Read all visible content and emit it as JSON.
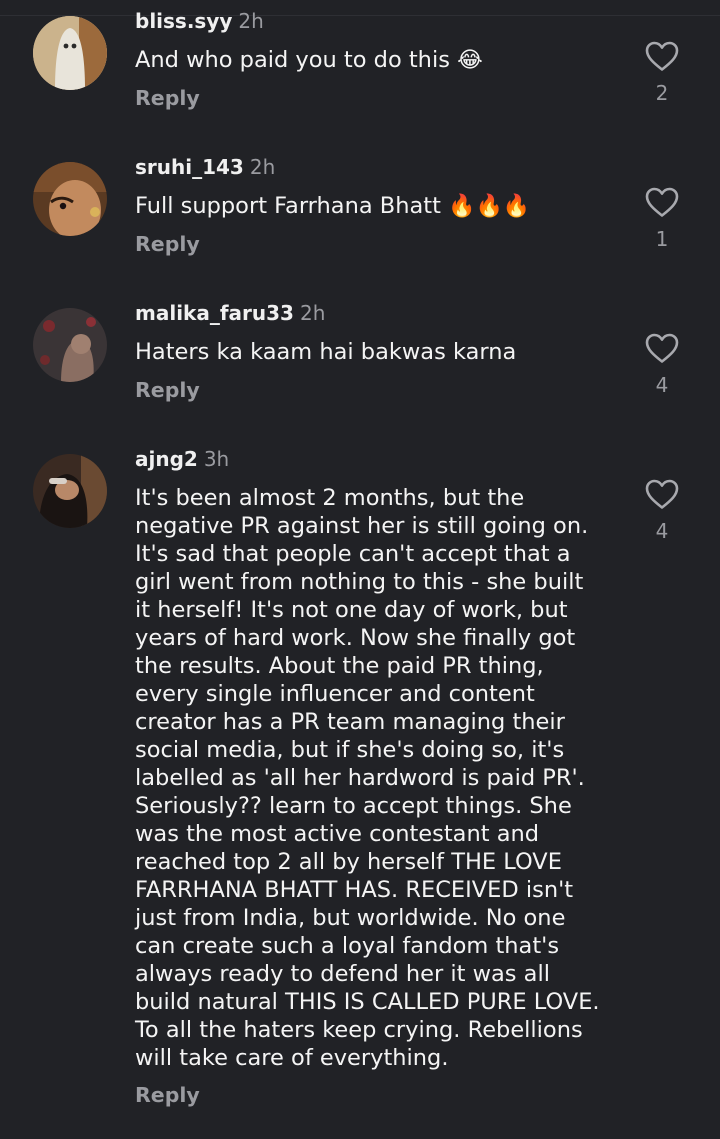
{
  "comments": [
    {
      "username": "bliss.syy",
      "time": "2h",
      "text": "And who paid you to do this",
      "emoji": "😂",
      "reply_label": "Reply",
      "likes": "2"
    },
    {
      "username": "sruhi_143",
      "time": "2h",
      "text": "Full support Farrhana Bhatt",
      "emoji": "🔥🔥🔥",
      "reply_label": "Reply",
      "likes": "1"
    },
    {
      "username": "malika_faru33",
      "time": "2h",
      "text": "Haters ka kaam hai bakwas karna",
      "reply_label": "Reply",
      "likes": "4"
    },
    {
      "username": "ajng2",
      "time": "3h",
      "text": "It's been almost 2 months, but the negative PR against her is still going on. It's sad that people can't accept that a girl went from nothing to this - she built it herself! It's not one day of work, but years of hard work. Now she finally got the results. About the paid PR thing, every single influencer and content creator has a PR team managing their social media, but if she's doing so, it's labelled as 'all her hardword is paid PR'. Seriously?? learn to accept things. She was the most active contestant and reached top 2 all by herself THE LOVE FARRHANA BHATT HAS. RECEIVED isn't just from India, but worldwide. No one can create such a loyal fandom that's always ready to defend her it was all build natural THIS IS CALLED PURE LOVE. To all the haters keep crying. Rebellions will take care of everything.",
      "reply_label": "Reply",
      "likes": "4"
    }
  ],
  "icons": {
    "like": "heart-outline-icon"
  },
  "colors": {
    "background": "#212226",
    "text": "#f4f4f4",
    "muted": "#9a9ba0"
  }
}
